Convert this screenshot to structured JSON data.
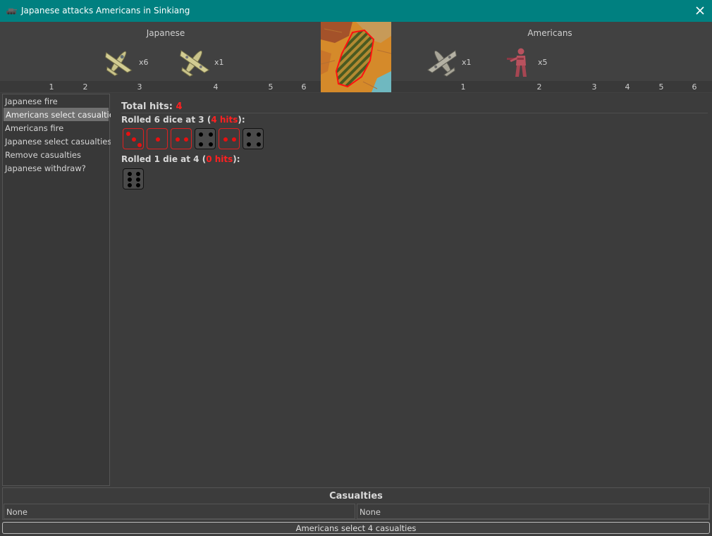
{
  "window": {
    "title": "Japanese attacks Americans in Sinkiang",
    "app_icon": "tank-icon",
    "close_icon": "close-icon"
  },
  "attacker": {
    "name": "Japanese",
    "units": [
      {
        "icon": "fighter-plane-icon",
        "count": "x6"
      },
      {
        "icon": "bomber-plane-icon",
        "count": "x1"
      }
    ],
    "roll_numbers": [
      "1",
      "2",
      "3",
      "4",
      "5",
      "6"
    ]
  },
  "defender": {
    "name": "Americans",
    "units": [
      {
        "icon": "bomber-plane-icon",
        "count": "x1"
      },
      {
        "icon": "infantry-soldier-icon",
        "count": "x5"
      }
    ],
    "roll_numbers": [
      "1",
      "2",
      "3",
      "4",
      "5",
      "6"
    ]
  },
  "territory_map": {
    "icon": "territory-map-icon",
    "territory": "Sinkiang"
  },
  "steps": [
    "Japanese fire",
    "Americans select casualties",
    "Americans fire",
    "Japanese select casualties",
    "Remove casualties",
    "Japanese withdraw?"
  ],
  "selected_step": "Americans select casualties",
  "results": {
    "total_label": "Total hits:",
    "total_value": "4",
    "rolls": [
      {
        "prefix": "Rolled 6 dice at 3 (",
        "hits": "4 hits",
        "suffix": "):",
        "dice": [
          {
            "value": 3,
            "hit": true
          },
          {
            "value": 1,
            "hit": true
          },
          {
            "value": 2,
            "hit": true
          },
          {
            "value": 4,
            "hit": false
          },
          {
            "value": 2,
            "hit": true
          },
          {
            "value": 4,
            "hit": false
          }
        ]
      },
      {
        "prefix": "Rolled 1 die at 4 (",
        "hits": "0 hits",
        "suffix": "):",
        "dice": [
          {
            "value": 6,
            "hit": false
          }
        ]
      }
    ]
  },
  "casualties": {
    "title": "Casualties",
    "left": "None",
    "right": "None"
  },
  "status_button": "Americans select 4 casualties",
  "colors": {
    "titlebar": "#008080",
    "hit": "#ff2020",
    "background": "#3c3c3c"
  }
}
